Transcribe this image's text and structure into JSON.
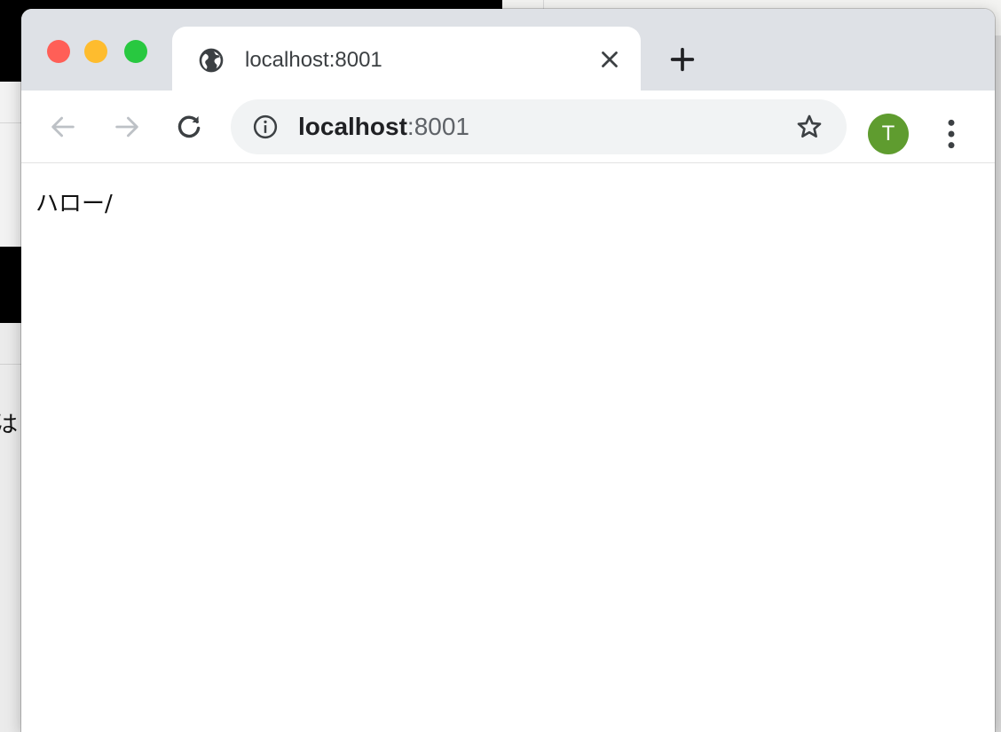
{
  "background": {
    "fragment_text": "は"
  },
  "window": {
    "controls": {
      "close_color": "#ff5f57",
      "minimize_color": "#febc2e",
      "maximize_color": "#28c840"
    }
  },
  "tab": {
    "icon": "globe-icon",
    "title": "localhost:8001",
    "close_icon": "close-icon"
  },
  "new_tab_icon": "plus-icon",
  "toolbar": {
    "back_icon": "arrow-left-icon",
    "forward_icon": "arrow-right-icon",
    "reload_icon": "reload-icon",
    "address": {
      "info_icon": "info-icon",
      "host": "localhost",
      "port": ":8001",
      "bookmark_icon": "star-icon"
    },
    "profile": {
      "initial": "T",
      "color": "#5f9c2f"
    },
    "menu_icon": "kebab-menu-icon"
  },
  "page": {
    "body_text": "ハロー/"
  }
}
